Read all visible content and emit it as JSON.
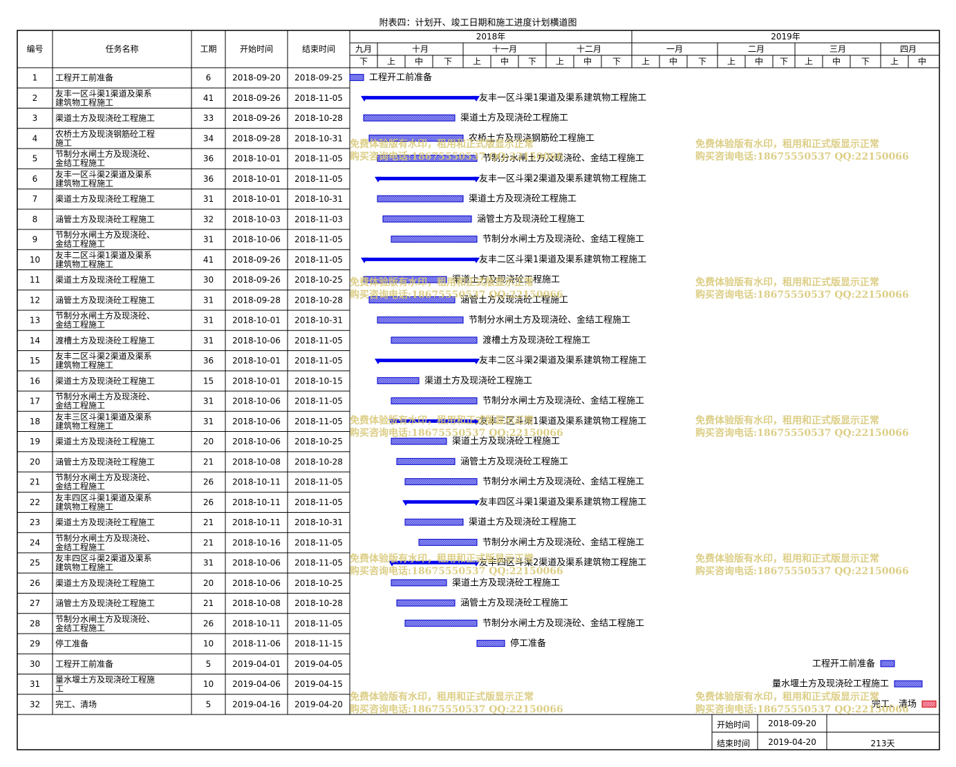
{
  "page_title": "附表四：计划开、竣工日期和施工进度计划横道图",
  "headers": {
    "no": "编号",
    "name": "任务名称",
    "days": "工期",
    "start": "开始时间",
    "end": "结束时间"
  },
  "timeline": {
    "years": [
      "2018年",
      "2019年"
    ],
    "months": [
      {
        "label": "九月",
        "year": 0
      },
      {
        "label": "十月",
        "year": 0
      },
      {
        "label": "十一月",
        "year": 0
      },
      {
        "label": "十二月",
        "year": 0
      },
      {
        "label": "一月",
        "year": 1
      },
      {
        "label": "二月",
        "year": 1
      },
      {
        "label": "三月",
        "year": 1
      },
      {
        "label": "四月",
        "year": 1
      }
    ],
    "period_labels": [
      "上",
      "中",
      "下"
    ],
    "first_visible_period": "下",
    "last_visible_period": "中"
  },
  "chart_data": {
    "type": "gantt",
    "title": "附表四：计划开、竣工日期和施工进度计划横道图",
    "x_range": [
      "2018-09-21",
      "2019-04-20"
    ],
    "legend": "none",
    "tasks": [
      {
        "id": "1",
        "name": "工程开工前准备",
        "days": "6",
        "start": "2018-09-20",
        "end": "2018-09-25",
        "kind": "task"
      },
      {
        "id": "2",
        "name": "友丰一区斗渠1渠道及渠系建筑物工程施工",
        "days": "41",
        "start": "2018-09-26",
        "end": "2018-11-05",
        "kind": "summary"
      },
      {
        "id": "3",
        "name": "渠道土方及现浇砼工程施工",
        "days": "33",
        "start": "2018-09-26",
        "end": "2018-10-28",
        "kind": "task"
      },
      {
        "id": "4",
        "name": "农桥土方及现浇钢筋砼工程施工",
        "days": "34",
        "start": "2018-09-28",
        "end": "2018-10-31",
        "kind": "task"
      },
      {
        "id": "5",
        "name": "节制分水闸土方及现浇砼、金结工程施工",
        "days": "36",
        "start": "2018-10-01",
        "end": "2018-11-05",
        "kind": "task"
      },
      {
        "id": "6",
        "name": "友丰一区斗渠2渠道及渠系建筑物工程施工",
        "days": "36",
        "start": "2018-10-01",
        "end": "2018-11-05",
        "kind": "summary"
      },
      {
        "id": "7",
        "name": "渠道土方及现浇砼工程施工",
        "days": "31",
        "start": "2018-10-01",
        "end": "2018-10-31",
        "kind": "task"
      },
      {
        "id": "8",
        "name": "涵管土方及现浇砼工程施工",
        "days": "32",
        "start": "2018-10-03",
        "end": "2018-11-03",
        "kind": "task"
      },
      {
        "id": "9",
        "name": "节制分水闸土方及现浇砼、金结工程施工",
        "days": "31",
        "start": "2018-10-06",
        "end": "2018-11-05",
        "kind": "task"
      },
      {
        "id": "10",
        "name": "友丰二区斗渠1渠道及渠系建筑物工程施工",
        "days": "41",
        "start": "2018-09-26",
        "end": "2018-11-05",
        "kind": "summary"
      },
      {
        "id": "11",
        "name": "渠道土方及现浇砼工程施工",
        "days": "30",
        "start": "2018-09-26",
        "end": "2018-10-25",
        "kind": "task"
      },
      {
        "id": "12",
        "name": "涵管土方及现浇砼工程施工",
        "days": "31",
        "start": "2018-09-28",
        "end": "2018-10-28",
        "kind": "task"
      },
      {
        "id": "13",
        "name": "节制分水闸土方及现浇砼、金结工程施工",
        "days": "31",
        "start": "2018-10-01",
        "end": "2018-10-31",
        "kind": "task"
      },
      {
        "id": "14",
        "name": "渡槽土方及现浇砼工程施工",
        "days": "31",
        "start": "2018-10-06",
        "end": "2018-11-05",
        "kind": "task"
      },
      {
        "id": "15",
        "name": "友丰二区斗渠2渠道及渠系建筑物工程施工",
        "days": "36",
        "start": "2018-10-01",
        "end": "2018-11-05",
        "kind": "summary"
      },
      {
        "id": "16",
        "name": "渠道土方及现浇砼工程施工",
        "days": "15",
        "start": "2018-10-01",
        "end": "2018-10-15",
        "kind": "task"
      },
      {
        "id": "17",
        "name": "节制分水闸土方及现浇砼、金结工程施工",
        "days": "31",
        "start": "2018-10-06",
        "end": "2018-11-05",
        "kind": "task"
      },
      {
        "id": "18",
        "name": "友丰三区斗渠1渠道及渠系建筑物工程施工",
        "days": "31",
        "start": "2018-10-06",
        "end": "2018-11-05",
        "kind": "summary"
      },
      {
        "id": "19",
        "name": "渠道土方及现浇砼工程施工",
        "days": "20",
        "start": "2018-10-06",
        "end": "2018-10-25",
        "kind": "task"
      },
      {
        "id": "20",
        "name": "涵管土方及现浇砼工程施工",
        "days": "21",
        "start": "2018-10-08",
        "end": "2018-10-28",
        "kind": "task"
      },
      {
        "id": "21",
        "name": "节制分水闸土方及现浇砼、金结工程施工",
        "days": "26",
        "start": "2018-10-11",
        "end": "2018-11-05",
        "kind": "task"
      },
      {
        "id": "22",
        "name": "友丰四区斗渠1渠道及渠系建筑物工程施工",
        "days": "26",
        "start": "2018-10-11",
        "end": "2018-11-05",
        "kind": "summary"
      },
      {
        "id": "23",
        "name": "渠道土方及现浇砼工程施工",
        "days": "21",
        "start": "2018-10-11",
        "end": "2018-10-31",
        "kind": "task"
      },
      {
        "id": "24",
        "name": "节制分水闸土方及现浇砼、金结工程施工",
        "days": "21",
        "start": "2018-10-16",
        "end": "2018-11-05",
        "kind": "task"
      },
      {
        "id": "25",
        "name": "友丰四区斗渠2渠道及渠系建筑物工程施工",
        "days": "31",
        "start": "2018-10-06",
        "end": "2018-11-05",
        "kind": "summary"
      },
      {
        "id": "26",
        "name": "渠道土方及现浇砼工程施工",
        "days": "20",
        "start": "2018-10-06",
        "end": "2018-10-25",
        "kind": "task"
      },
      {
        "id": "27",
        "name": "涵管土方及现浇砼工程施工",
        "days": "21",
        "start": "2018-10-08",
        "end": "2018-10-28",
        "kind": "task"
      },
      {
        "id": "28",
        "name": "节制分水闸土方及现浇砼、金结工程施工",
        "days": "26",
        "start": "2018-10-11",
        "end": "2018-11-05",
        "kind": "task"
      },
      {
        "id": "29",
        "name": "停工准备",
        "days": "10",
        "start": "2018-11-06",
        "end": "2018-11-15",
        "kind": "task"
      },
      {
        "id": "30",
        "name": "工程开工前准备",
        "days": "5",
        "start": "2019-04-01",
        "end": "2019-04-05",
        "kind": "task",
        "label_side": "left"
      },
      {
        "id": "31",
        "name": "量水堰土方及现浇砼工程施工",
        "days": "10",
        "start": "2019-04-06",
        "end": "2019-04-15",
        "kind": "task",
        "label_side": "left"
      },
      {
        "id": "32",
        "name": "完工、清场",
        "days": "5",
        "start": "2019-04-16",
        "end": "2019-04-20",
        "kind": "critical",
        "label_side": "left"
      }
    ]
  },
  "summary": {
    "start_label": "开始时间",
    "start_value": "2018-09-20",
    "end_label": "结束时间",
    "end_value": "2019-04-20",
    "total": "213天"
  },
  "watermark": {
    "line1": "免费体验版有水印，租用和正式版显示正常",
    "line2": "购买咨询电话:18675550537 QQ:22150066"
  },
  "colors": {
    "task_fill": "#6f6fe8",
    "task_border": "#0000cc",
    "summary": "#0000ee",
    "critical_fill": "#e8607a",
    "critical_border": "#cc0000",
    "watermark": "#d9c97a"
  }
}
